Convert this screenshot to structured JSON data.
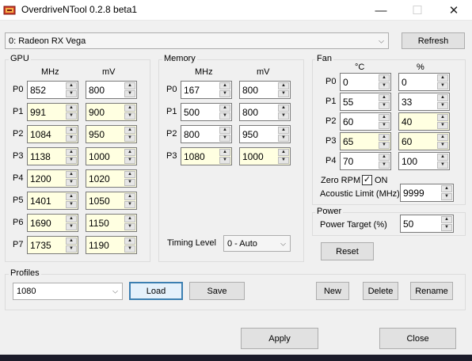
{
  "window": {
    "title": "OverdriveNTool 0.2.8 beta1",
    "minimize_glyph": "—",
    "maximize_glyph": "☐",
    "close_glyph": "✕"
  },
  "gpu_select": {
    "value": "0: Radeon RX Vega",
    "refresh_label": "Refresh"
  },
  "gpu_group": {
    "label": "GPU",
    "col_mhz": "MHz",
    "col_mv": "mV",
    "rows": [
      {
        "p": "P0",
        "mhz": "852",
        "mv": "800"
      },
      {
        "p": "P1",
        "mhz": "991",
        "mv": "900"
      },
      {
        "p": "P2",
        "mhz": "1084",
        "mv": "950"
      },
      {
        "p": "P3",
        "mhz": "1138",
        "mv": "1000"
      },
      {
        "p": "P4",
        "mhz": "1200",
        "mv": "1020"
      },
      {
        "p": "P5",
        "mhz": "1401",
        "mv": "1050"
      },
      {
        "p": "P6",
        "mhz": "1690",
        "mv": "1150"
      },
      {
        "p": "P7",
        "mhz": "1735",
        "mv": "1190"
      }
    ]
  },
  "memory_group": {
    "label": "Memory",
    "col_mhz": "MHz",
    "col_mv": "mV",
    "rows": [
      {
        "p": "P0",
        "mhz": "167",
        "mv": "800"
      },
      {
        "p": "P1",
        "mhz": "500",
        "mv": "800"
      },
      {
        "p": "P2",
        "mhz": "800",
        "mv": "950"
      },
      {
        "p": "P3",
        "mhz": "1080",
        "mv": "1000"
      }
    ],
    "timing_label": "Timing Level",
    "timing_value": "0 - Auto"
  },
  "fan_group": {
    "label": "Fan",
    "col_c": "°C",
    "col_pct": "%",
    "rows": [
      {
        "p": "P0",
        "c": "0",
        "pct": "0"
      },
      {
        "p": "P1",
        "c": "55",
        "pct": "33"
      },
      {
        "p": "P2",
        "c": "60",
        "pct": "40"
      },
      {
        "p": "P3",
        "c": "65",
        "pct": "60"
      },
      {
        "p": "P4",
        "c": "70",
        "pct": "100"
      }
    ],
    "zero_rpm_label": "Zero RPM",
    "zero_rpm_check": "✓",
    "zero_rpm_on": "ON",
    "acoustic_label": "Acoustic Limit (MHz)",
    "acoustic_value": "9999"
  },
  "power_group": {
    "label": "Power",
    "target_label": "Power Target (%)",
    "target_value": "50"
  },
  "reset_label": "Reset",
  "profiles": {
    "label": "Profiles",
    "value": "1080",
    "load_label": "Load",
    "save_label": "Save",
    "new_label": "New",
    "delete_label": "Delete",
    "rename_label": "Rename"
  },
  "footer": {
    "apply_label": "Apply",
    "close_label": "Close"
  },
  "colors": {
    "highlight_field": "#ffffe1",
    "window_bg": "#f0f0f0",
    "focus_border": "#3c7fb1"
  }
}
